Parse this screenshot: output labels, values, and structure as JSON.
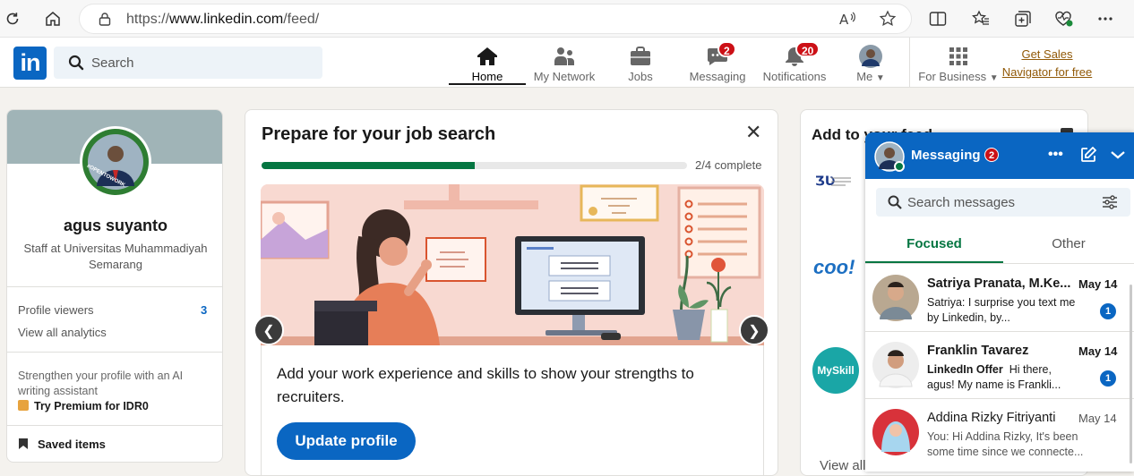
{
  "browser": {
    "url_prefix": "https://",
    "url_host": "www.linkedin.com",
    "url_path": "/feed/"
  },
  "nav": {
    "search_placeholder": "Search",
    "home": "Home",
    "network": "My Network",
    "jobs": "Jobs",
    "messaging": "Messaging",
    "messaging_badge": "2",
    "notifications": "Notifications",
    "notifications_badge": "20",
    "me": "Me",
    "for_business": "For Business",
    "sales_nav_line1": "Get Sales",
    "sales_nav_line2": "Navigator for free"
  },
  "profile": {
    "name": "agus suyanto",
    "headline": "Staff at Universitas Muhammadiyah Semarang",
    "frame_text": "#OPENTOWORK",
    "viewers_label": "Profile viewers",
    "viewers_count": "3",
    "analytics": "View all analytics",
    "promo_text": "Strengthen your profile with an AI writing assistant",
    "premium": "Try Premium for IDR0",
    "saved": "Saved items"
  },
  "job_card": {
    "title": "Prepare for your job search",
    "progress_text": "2/4 complete",
    "progress_fraction": 0.5,
    "body": "Add your work experience and skills to show your strengths to recruiters.",
    "button": "Update profile",
    "prev": "❮",
    "next": "❯"
  },
  "feed_card": {
    "title": "Add to your feed",
    "view_all": "View all",
    "logo2_text": "coo!",
    "logo3_text": "MySkill"
  },
  "messaging": {
    "title": "Messaging",
    "badge": "2",
    "search_placeholder": "Search messages",
    "tab_focused": "Focused",
    "tab_other": "Other",
    "conversations": [
      {
        "name": "Satriya Pranata, M.Ke...",
        "date": "May 14",
        "snippet": "Satriya: I surprise you text me by Linkedin, by...",
        "unread": "1"
      },
      {
        "name": "Franklin Tavarez",
        "date": "May 14",
        "tag": "LinkedIn Offer",
        "snippet": "Hi there, agus! My name is Frankli...",
        "unread": "1"
      },
      {
        "name": "Addina Rizky Fitriyanti",
        "date": "May 14",
        "snippet": "You: Hi Addina Rizky, It's been some time since we connecte..."
      }
    ]
  }
}
